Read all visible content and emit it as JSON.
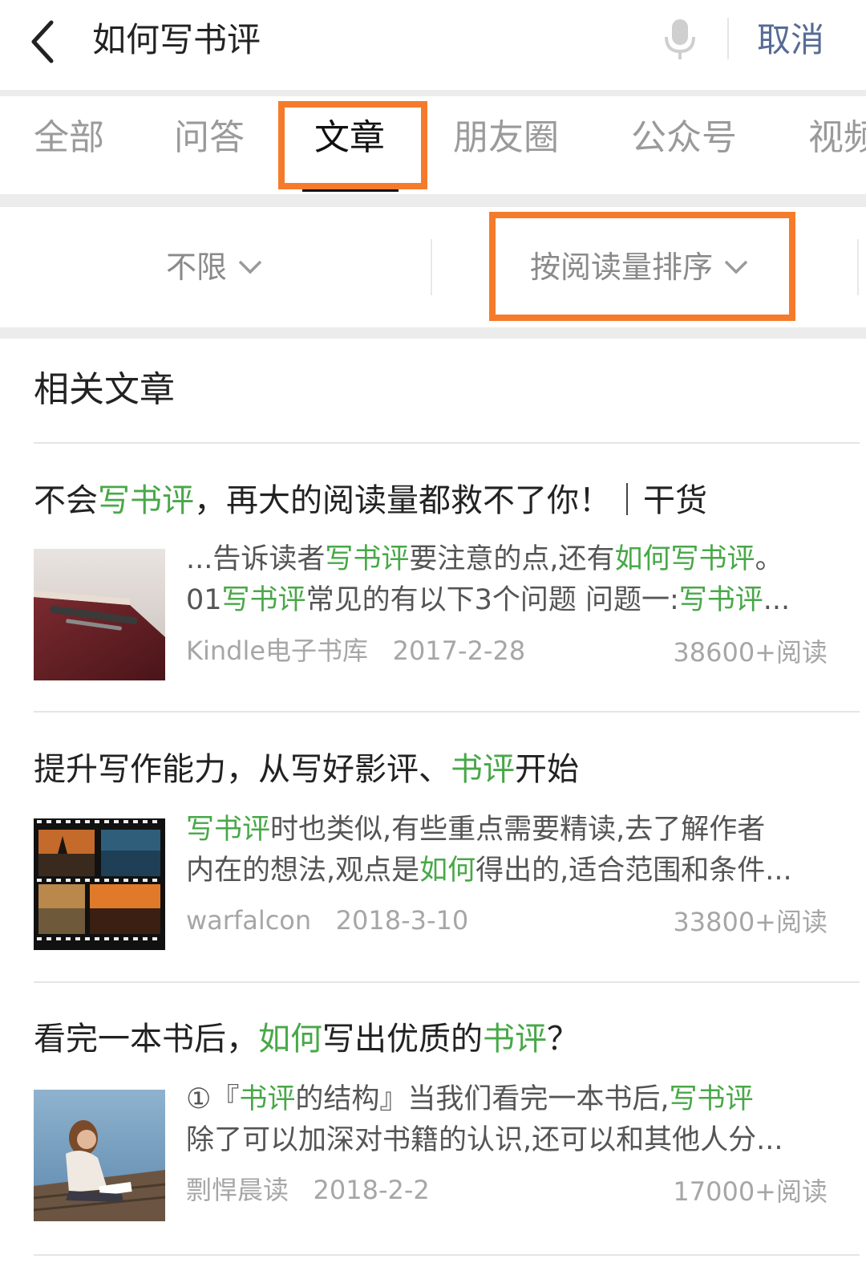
{
  "search": {
    "query": "如何写书评",
    "cancel_label": "取消"
  },
  "tabs": [
    {
      "label": "全部"
    },
    {
      "label": "问答"
    },
    {
      "label": "文章",
      "active": true
    },
    {
      "label": "朋友圈"
    },
    {
      "label": "公众号"
    },
    {
      "label": "视频"
    }
  ],
  "filters": {
    "time": "不限",
    "sort": "按阅读量排序"
  },
  "section_title": "相关文章",
  "highlight_color": "#48a848",
  "annotation_color": "#f47b2b",
  "articles": [
    {
      "title_parts": [
        "不会",
        "写书评",
        "，再大的阅读量都救不了你！｜干货"
      ],
      "snippet1_parts": [
        "...告诉读者",
        "写书评",
        "要注意的点,还有",
        "如何写书评",
        "。"
      ],
      "snippet2_parts": [
        "01",
        "写书评",
        "常见的有以下3个问题 问题一:",
        "写书评",
        "..."
      ],
      "source": "Kindle电子书库",
      "date": "2017-2-28",
      "reads": "38600+阅读"
    },
    {
      "title_parts": [
        "提升写作能力，从写好影评、",
        "书评",
        "开始"
      ],
      "snippet1_parts": [
        "",
        "写书评",
        "时也类似,有些重点需要精读,去了解作者"
      ],
      "snippet2_parts": [
        "内在的想法,观点是",
        "如何",
        "得出的,适合范围和条件..."
      ],
      "source": "warfalcon",
      "date": "2018-3-10",
      "reads": "33800+阅读"
    },
    {
      "title_parts": [
        "看完一本书后，",
        "如何",
        "写出优质的",
        "书评",
        "？"
      ],
      "snippet1_parts": [
        "①『",
        "书评",
        "的结构』当我们看完一本书后,",
        "写书评"
      ],
      "snippet2_parts": [
        "除了可以加深对书籍的认识,还可以和其他人分..."
      ],
      "source": "剽悍晨读",
      "date": "2018-2-2",
      "reads": "17000+阅读"
    }
  ]
}
